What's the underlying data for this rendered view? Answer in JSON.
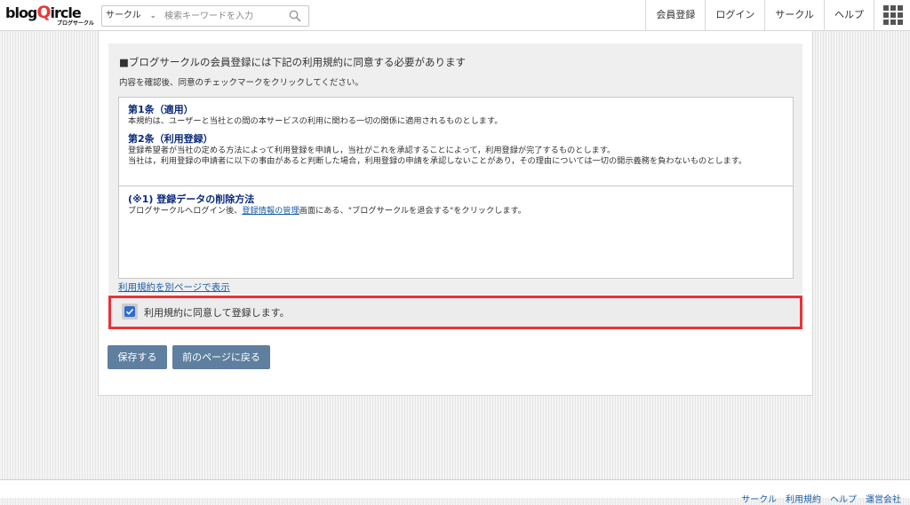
{
  "header": {
    "logo_text_left": "blog",
    "logo_text_q": "Q",
    "logo_text_right": "ircle",
    "logo_sub": "ブログサークル",
    "search_category": "サークル",
    "search_placeholder": "検索キーワードを入力",
    "nav": [
      "会員登録",
      "ログイン",
      "サークル",
      "ヘルプ"
    ]
  },
  "main": {
    "notice_title": "■ブログサークルの会員登録には下記の利用規約に同意する必要があります",
    "notice_sub": "内容を確認後、同意のチェックマークをクリックしてください。",
    "article1_title": "第1条（適用）",
    "article1_text": "本規約は、ユーザーと当社との間の本サービスの利用に関わる一切の関係に適用されるものとします。",
    "article2_title": "第2条（利用登録）",
    "article2_text1": "登録希望者が当社の定める方法によって利用登録を申請し，当社がこれを承認することによって，利用登録が完了するものとします。",
    "article2_text2": "当社は，利用登録の申請者に以下の事由があると判断した場合，利用登録の申請を承認しないことがあり，その理由については一切の開示義務を負わないものとします。",
    "note_title": "(※1) 登録データの削除方法",
    "note_text_before": "ブログサークルへログイン後、",
    "note_link": "登録情報の管理",
    "note_text_after": "画面にある、\"ブログサークルを退会する\"をクリックします。",
    "terms_link": "利用規約を別ページで表示",
    "agree_label": "利用規約に同意して登録します。",
    "agree_checked": true,
    "save_button": "保存する",
    "back_button": "前のページに戻る"
  },
  "footer": {
    "links": [
      "サークル",
      "利用規約",
      "ヘルプ",
      "運営会社"
    ]
  },
  "colors": {
    "button": "#5e7f9f",
    "highlight_border": "#e8323a",
    "link": "#1a5fa8",
    "article_title": "#0b2a7a",
    "checkbox": "#2e6bd1"
  }
}
